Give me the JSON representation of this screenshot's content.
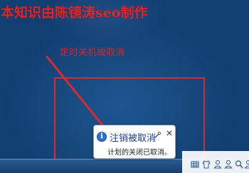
{
  "watermark": {
    "text": "本知识由陈镜涛seo制作"
  },
  "annotation": {
    "text": "定时关机被取消"
  },
  "notification": {
    "title": "注销被取消",
    "body": "计划的关闭已取消。",
    "icon": "info-icon"
  },
  "tray": {
    "icons": [
      "grid-icon",
      "shirt-icon",
      "person-icon",
      "person-icon",
      "search-icon",
      "person-icon"
    ]
  },
  "colors": {
    "annotation_red": "#d92a2f",
    "desktop_blue": "#123f72",
    "notification_title": "#1c3f9a"
  }
}
